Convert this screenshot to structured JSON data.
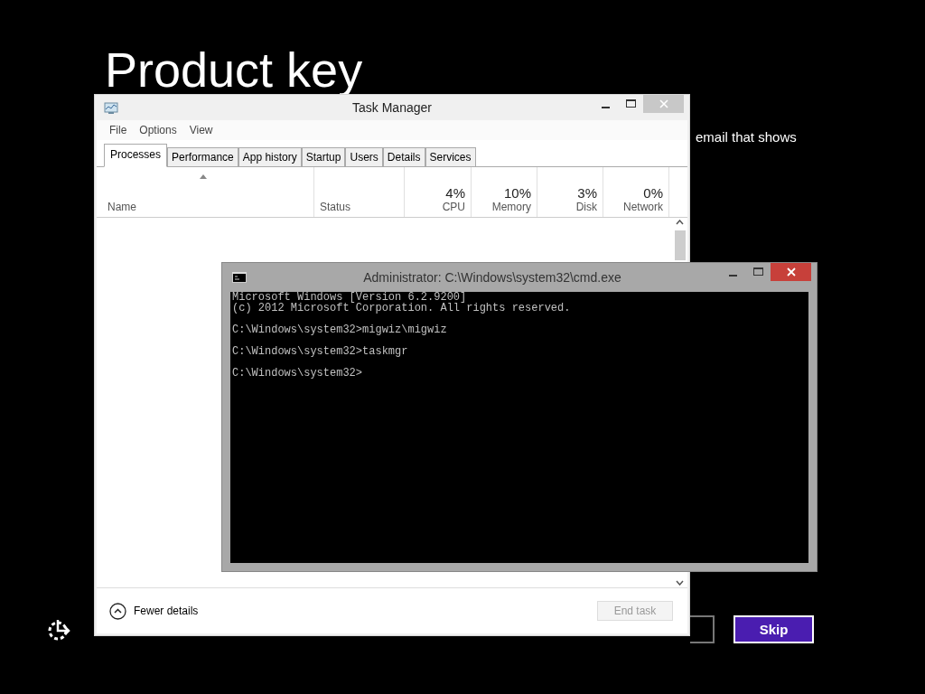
{
  "setup": {
    "title": "Product key",
    "description_fragment": "email that shows",
    "buttons": [
      {
        "kind": "outline"
      },
      {
        "label": "Skip",
        "kind": "primary"
      }
    ]
  },
  "task_manager": {
    "title": "Task Manager",
    "menu": [
      "File",
      "Options",
      "View"
    ],
    "tabs": [
      {
        "label": "Processes",
        "selected": true
      },
      {
        "label": "Performance",
        "selected": false
      },
      {
        "label": "App history",
        "selected": false
      },
      {
        "label": "Startup",
        "selected": false
      },
      {
        "label": "Users",
        "selected": false
      },
      {
        "label": "Details",
        "selected": false
      },
      {
        "label": "Services",
        "selected": false
      }
    ],
    "columns": [
      {
        "name": "Name",
        "sorted": true
      },
      {
        "name": "Status",
        "sorted": false
      },
      {
        "name": "CPU",
        "usage": "4%",
        "sorted": false
      },
      {
        "name": "Memory",
        "usage": "10%",
        "sorted": false
      },
      {
        "name": "Disk",
        "usage": "3%",
        "sorted": false
      },
      {
        "name": "Network",
        "usage": "0%",
        "sorted": false
      }
    ],
    "fewer_details": "Fewer details",
    "end_task": {
      "label": "End task",
      "disabled": true
    }
  },
  "cmd": {
    "title": "Administrator: C:\\Windows\\system32\\cmd.exe",
    "lines": [
      {
        "text": "Microsoft Windows [Version 6.2.9200]",
        "blank_before": false
      },
      {
        "text": "(c) 2012 Microsoft Corporation. All rights reserved.",
        "blank_before": false
      },
      {
        "text": "C:\\Windows\\system32>migwiz\\migwiz",
        "blank_before": true
      },
      {
        "text": "C:\\Windows\\system32>taskmgr",
        "blank_before": true
      },
      {
        "text": "C:\\Windows\\system32>",
        "blank_before": true
      }
    ]
  }
}
